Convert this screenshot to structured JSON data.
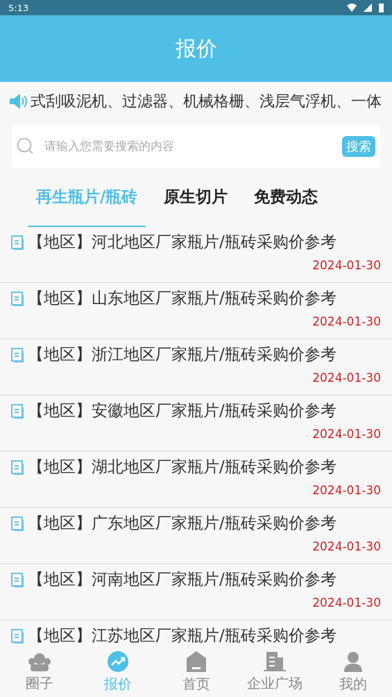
{
  "status_bar": {
    "time": "5:13"
  },
  "header": {
    "title": "报价"
  },
  "ticker": {
    "text": "式刮吸泥机、过滤器、机械格栅、浅层气浮机、一体"
  },
  "search": {
    "placeholder": "请输入您需要搜索的内容",
    "button": "搜索"
  },
  "tabs": [
    {
      "label": "再生瓶片/瓶砖",
      "selected": true
    },
    {
      "label": "原生切片",
      "selected": false
    },
    {
      "label": "免费动态",
      "selected": false
    }
  ],
  "items": [
    {
      "title": "【地区】河北地区厂家瓶片/瓶砖采购价参考",
      "date": "2024-01-30"
    },
    {
      "title": "【地区】山东地区厂家瓶片/瓶砖采购价参考",
      "date": "2024-01-30"
    },
    {
      "title": "【地区】浙江地区厂家瓶片/瓶砖采购价参考",
      "date": "2024-01-30"
    },
    {
      "title": "【地区】安徽地区厂家瓶片/瓶砖采购价参考",
      "date": "2024-01-30"
    },
    {
      "title": "【地区】湖北地区厂家瓶片/瓶砖采购价参考",
      "date": "2024-01-30"
    },
    {
      "title": "【地区】广东地区厂家瓶片/瓶砖采购价参考",
      "date": "2024-01-30"
    },
    {
      "title": "【地区】河南地区厂家瓶片/瓶砖采购价参考",
      "date": "2024-01-30"
    },
    {
      "title": "【地区】江苏地区厂家瓶片/瓶砖采购价参考"
    }
  ],
  "nav": [
    {
      "label": "圈子",
      "kind": "group",
      "selected": false
    },
    {
      "label": "报价",
      "kind": "chart",
      "selected": true
    },
    {
      "label": "首页",
      "kind": "home",
      "selected": false
    },
    {
      "label": "企业广场",
      "kind": "building",
      "selected": false
    },
    {
      "label": "我的",
      "kind": "person",
      "selected": false
    }
  ]
}
